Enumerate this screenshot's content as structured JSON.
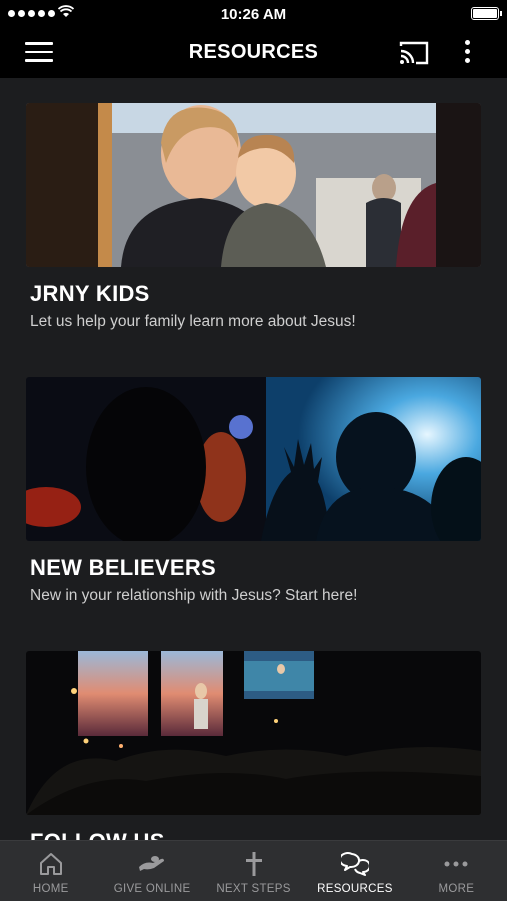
{
  "status_bar": {
    "time": "10:26 AM"
  },
  "header": {
    "title": "RESOURCES"
  },
  "cards": [
    {
      "title": "JRNY KIDS",
      "subtitle": "Let us help your family learn more about Jesus!"
    },
    {
      "title": "NEW BELIEVERS",
      "subtitle": "New in your relationship with Jesus? Start here!"
    },
    {
      "title": "FOLLOW US",
      "subtitle": ""
    }
  ],
  "tabs": [
    {
      "label": "HOME",
      "icon": "home-icon"
    },
    {
      "label": "GIVE ONLINE",
      "icon": "give-hand-icon"
    },
    {
      "label": "NEXT STEPS",
      "icon": "cross-icon"
    },
    {
      "label": "RESOURCES",
      "icon": "chat-bubbles-icon",
      "active": true
    },
    {
      "label": "MORE",
      "icon": "more-dots-icon"
    }
  ],
  "colors": {
    "background": "#1c1d1f",
    "header": "#000000",
    "tabbar": "#2e2f31",
    "tab_inactive": "#9a9a9c"
  }
}
